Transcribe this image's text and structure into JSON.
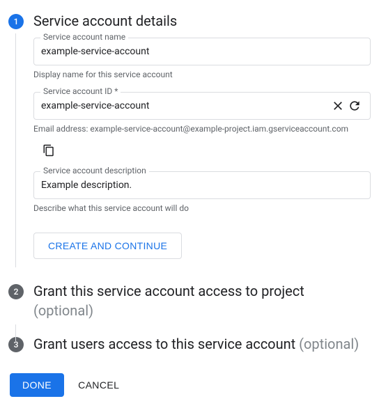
{
  "steps": {
    "one": {
      "num": "1",
      "title": "Service account details"
    },
    "two": {
      "num": "2",
      "title": "Grant this service account access to project",
      "optional": "(optional)"
    },
    "three": {
      "num": "3",
      "title": "Grant users access to this service account ",
      "optional": "(optional)"
    }
  },
  "fields": {
    "name": {
      "label": "Service account name",
      "value": "example-service-account",
      "helper": "Display name for this service account"
    },
    "id": {
      "label": "Service account ID *",
      "value": "example-service-account",
      "helper": "Email address: example-service-account@example-project.iam.gserviceaccount.com"
    },
    "desc": {
      "label": "Service account description",
      "value": "Example description.",
      "helper": "Describe what this service account will do"
    }
  },
  "buttons": {
    "create": "CREATE AND CONTINUE",
    "done": "DONE",
    "cancel": "CANCEL"
  }
}
